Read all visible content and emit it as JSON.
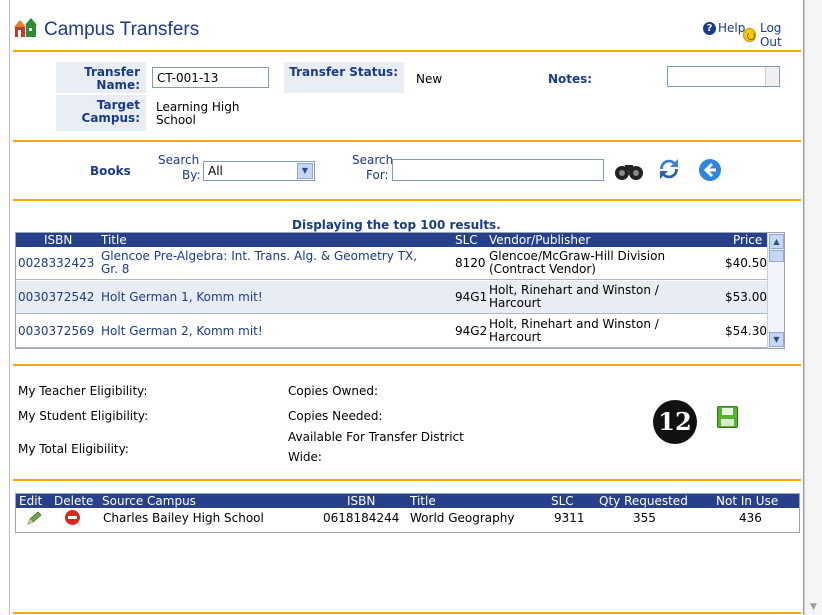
{
  "app": {
    "title": "Campus Transfers",
    "help_label": "Help",
    "logout_label": "Log Out"
  },
  "transfer": {
    "name_label": "Transfer Name:",
    "name_value": "CT-001-13",
    "status_label": "Transfer Status:",
    "status_value": "New",
    "notes_label": "Notes:",
    "target_label": "Target Campus:",
    "target_value_line1": "Learning High",
    "target_value_line2": "School"
  },
  "search": {
    "section_label": "Books",
    "search_by_label_1": "Search",
    "search_by_label_2": "By:",
    "search_by_value": "All",
    "search_for_label_1": "Search",
    "search_for_label_2": "For:",
    "search_for_value": ""
  },
  "results": {
    "title": "Displaying the top 100 results.",
    "columns": [
      "ISBN",
      "Title",
      "SLC",
      "Vendor/Publisher",
      "Price"
    ],
    "rows": [
      {
        "isbn": "0028332423",
        "title_line1": "Glencoe Pre-Algebra: Int. Trans. Alg. & Geometry TX,",
        "title_line2": "Gr. 8",
        "slc": "8120",
        "vendor_line1": "Glencoe/McGraw-Hill Division",
        "vendor_line2": "(Contract Vendor)",
        "price": "$40.50"
      },
      {
        "isbn": "0030372542",
        "title_line1": "Holt German 1, Komm mit!",
        "title_line2": "",
        "slc": "94G1",
        "vendor_line1": "Holt, Rinehart and Winston /",
        "vendor_line2": "Harcourt",
        "price": "$53.00"
      },
      {
        "isbn": "0030372569",
        "title_line1": "Holt German 2, Komm mit!",
        "title_line2": "",
        "slc": "94G2",
        "vendor_line1": "Holt, Rinehart and Winston /",
        "vendor_line2": "Harcourt",
        "price": "$54.30"
      }
    ]
  },
  "eligibility": {
    "teacher": "My Teacher Eligibility:",
    "student": "My Student Eligibility:",
    "total": "My Total Eligibility:",
    "copies_owned": "Copies Owned:",
    "copies_needed": "Copies Needed:",
    "available_line1": "Available For Transfer District",
    "available_line2": "Wide:"
  },
  "step_badge": "12",
  "requests": {
    "columns": [
      "Edit",
      "Delete",
      "Source Campus",
      "ISBN",
      "Title",
      "SLC",
      "Qty Requested",
      "Not In Use"
    ],
    "row": {
      "source_campus": "Charles Bailey High School",
      "isbn": "0618184244",
      "title": "World Geography",
      "slc": "9311",
      "qty_requested": "355",
      "not_in_use": "436"
    }
  },
  "colors": {
    "accent_rule": "#f5a800",
    "header_blue": "#27408b",
    "label_blue": "#1a3a8c"
  }
}
